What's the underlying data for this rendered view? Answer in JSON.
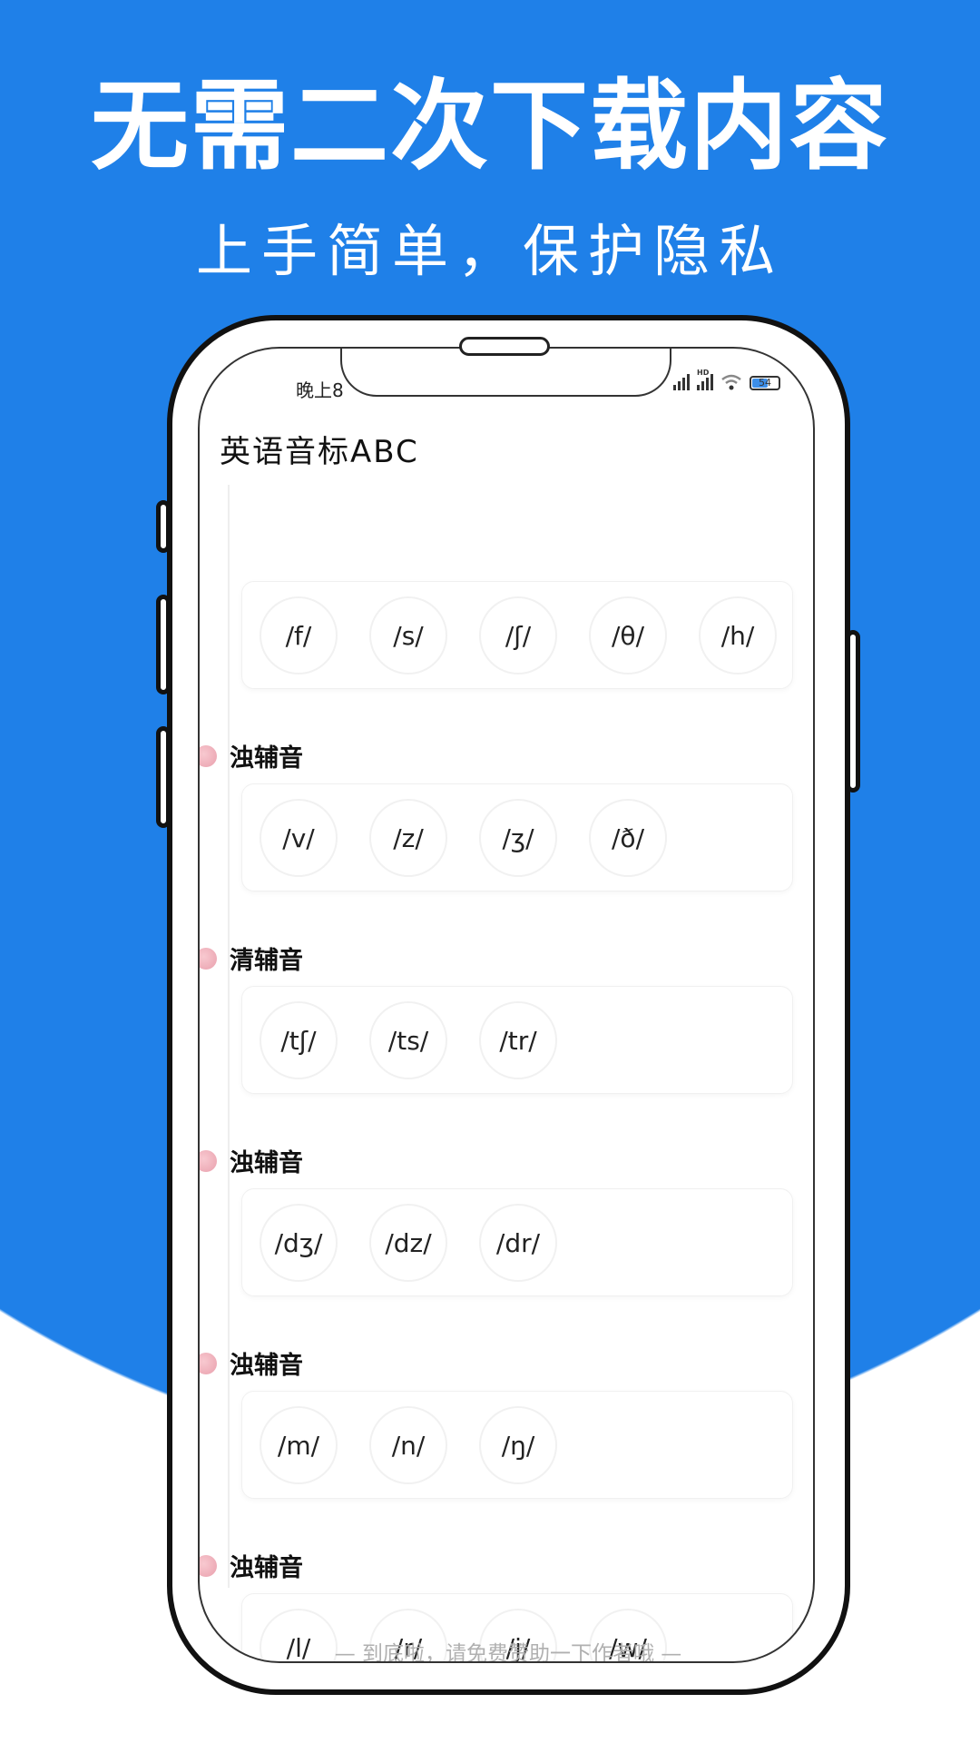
{
  "banner": {
    "title": "无需二次下载内容",
    "subtitle": "上手简单，保护隐私",
    "bg_color": "#1f80e8"
  },
  "status_bar": {
    "time": "晚上8",
    "hd_label": "HD",
    "battery": "54",
    "icons": [
      "signal-icon",
      "hd-signal-icon",
      "wifi-icon",
      "battery-icon"
    ]
  },
  "app": {
    "title": "英语音标ABC"
  },
  "sections": [
    {
      "title": "",
      "items": [
        "/f/",
        "/s/",
        "/ʃ/",
        "/θ/",
        "/h/"
      ]
    },
    {
      "title": "浊辅音",
      "items": [
        "/v/",
        "/z/",
        "/ʒ/",
        "/ð/"
      ]
    },
    {
      "title": "清辅音",
      "items": [
        "/tʃ/",
        "/ts/",
        "/tr/"
      ]
    },
    {
      "title": "浊辅音",
      "items": [
        "/dʒ/",
        "/dz/",
        "/dr/"
      ]
    },
    {
      "title": "浊辅音",
      "items": [
        "/m/",
        "/n/",
        "/ŋ/"
      ]
    },
    {
      "title": "浊辅音",
      "items": [
        "/l/",
        "/r/",
        "/j/",
        "/w/"
      ]
    }
  ],
  "footer": {
    "text": "— 到底啦，请免费赞助一下作者哦 —"
  }
}
